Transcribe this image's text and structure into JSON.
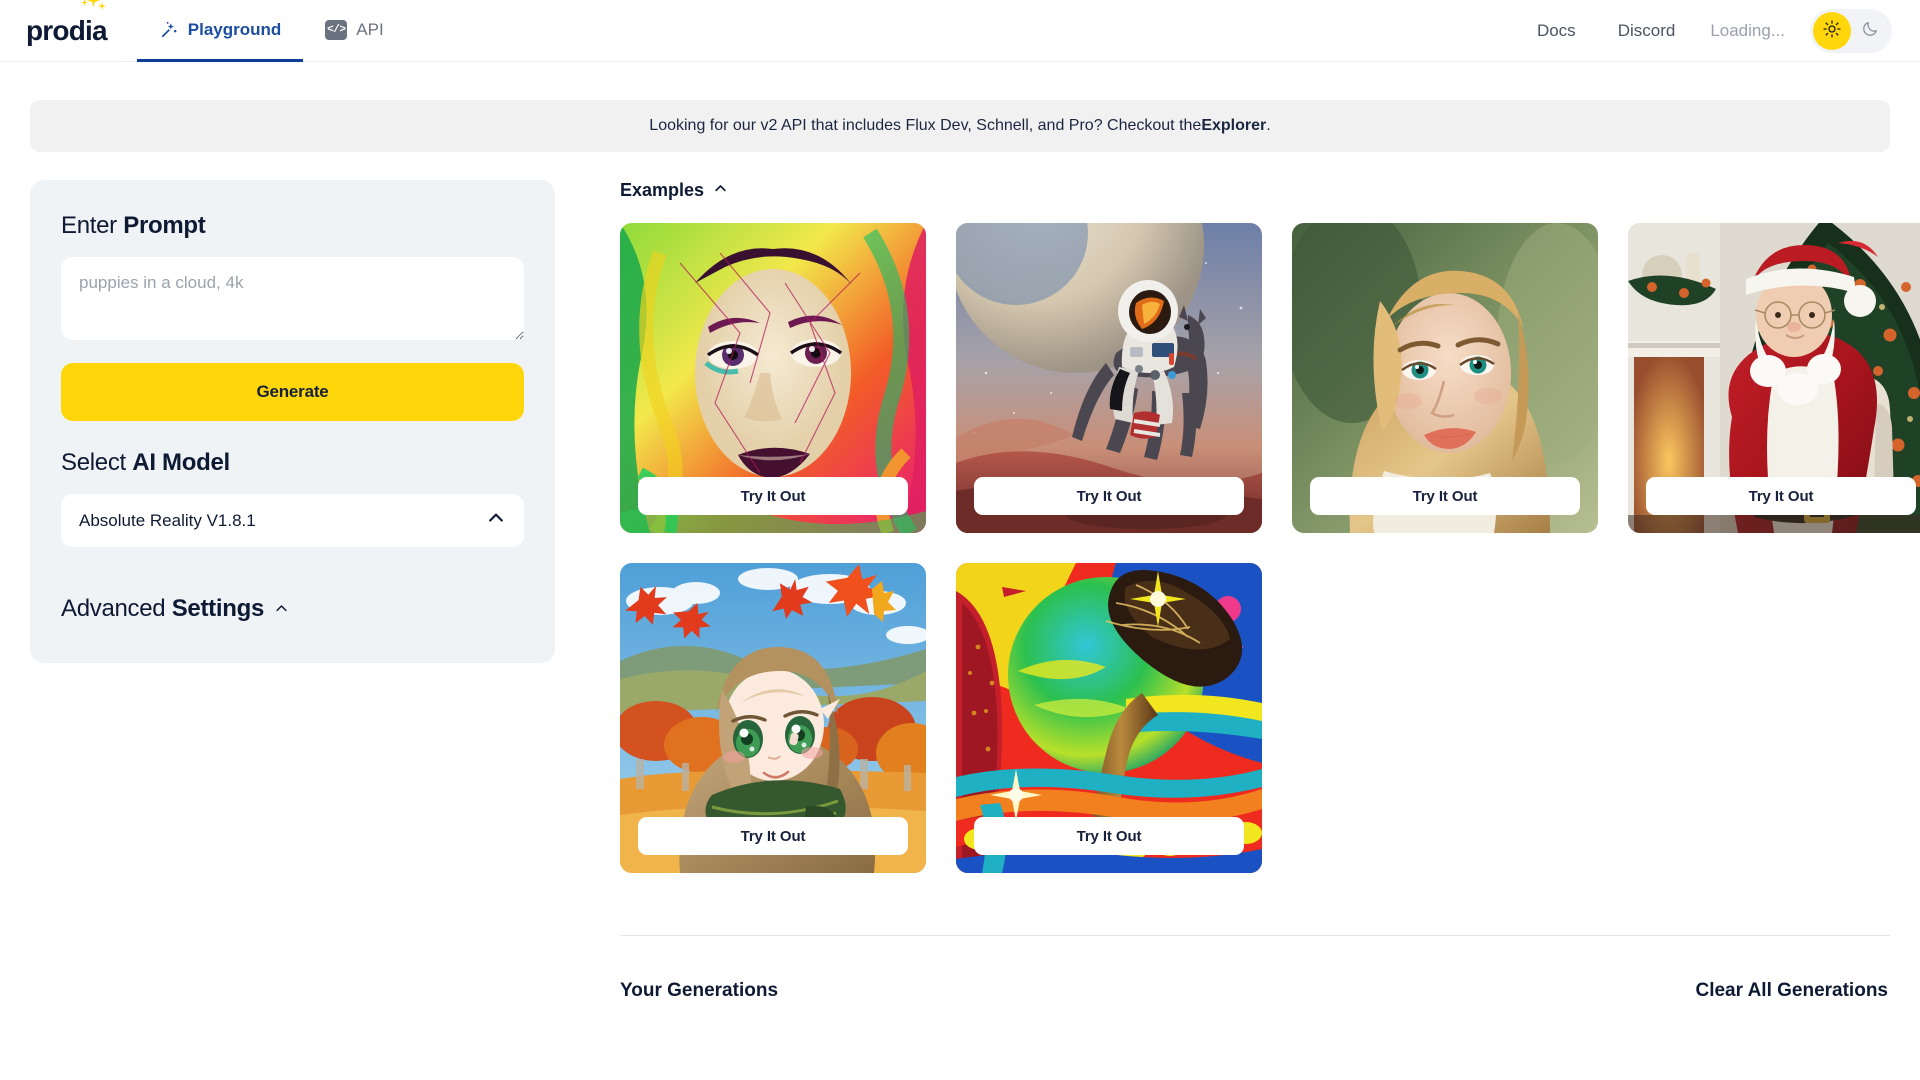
{
  "header": {
    "logo": "prodia",
    "tabs": [
      {
        "label": "Playground",
        "icon": "magic-wand-icon",
        "active": true
      },
      {
        "label": "API",
        "icon": "code-icon",
        "active": false
      }
    ],
    "links": [
      "Docs",
      "Discord"
    ],
    "docs_label": "Docs",
    "discord_label": "Discord",
    "status": "Loading...",
    "theme": {
      "light_icon": "sun-icon",
      "dark_icon": "moon-icon",
      "active": "light",
      "active_color": "#ffd60a"
    }
  },
  "banner": {
    "text_before": "Looking for our v2 API that includes Flux Dev, Schnell, and Pro? Checkout the ",
    "link": "Explorer",
    "text_after": "."
  },
  "sidebar": {
    "prompt": {
      "label_light": "Enter ",
      "label_bold": "Prompt",
      "placeholder": "puppies in a cloud, 4k",
      "value": ""
    },
    "generate_label": "Generate",
    "model": {
      "label_light": "Select ",
      "label_bold": "AI Model",
      "selected": "Absolute Reality V1.8.1",
      "chevron": "chevron-up-icon"
    },
    "advanced": {
      "label_light": "Advanced ",
      "label_bold": "Settings",
      "chevron": "chevron-up-icon"
    }
  },
  "main": {
    "examples_label": "Examples",
    "examples_chevron": "chevron-up-icon",
    "try_label": "Try It Out",
    "cards": [
      {
        "name": "colorful-painted-woman-portrait",
        "button": "Try It Out"
      },
      {
        "name": "astronaut-riding-horse-on-mars",
        "button": "Try It Out"
      },
      {
        "name": "blonde-woman-photo-portrait",
        "button": "Try It Out"
      },
      {
        "name": "santa-claus-by-christmas-tree",
        "button": "Try It Out"
      },
      {
        "name": "anime-girl-autumn-landscape",
        "button": "Try It Out"
      },
      {
        "name": "psychedelic-tree-landscape",
        "button": "Try It Out"
      }
    ],
    "generations_title": "Your Generations",
    "clear_all_label": "Clear All Generations"
  }
}
